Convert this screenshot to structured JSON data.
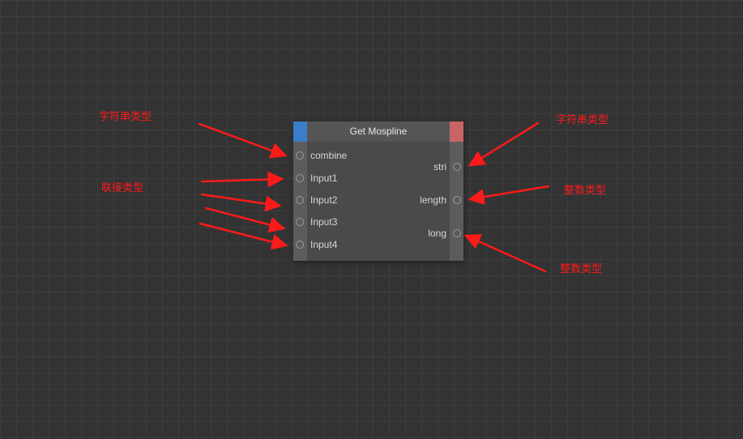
{
  "node": {
    "title": "Get Mospline",
    "inputs": [
      "combine",
      "Input1",
      "Input2",
      "Input3",
      "Input4"
    ],
    "outputs": [
      "stri",
      "length",
      "long"
    ]
  },
  "annotations": {
    "string_type_in": "字符串类型",
    "link_type": "联接类型",
    "string_type_out": "字符串类型",
    "int_type_length": "整数类型",
    "int_type_long": "整数类型"
  },
  "colors": {
    "canvas_bg": "#333333",
    "grid_line": "#3d3d3d",
    "node_body": "#4a4a4a",
    "input_accent": "#3a7dc9",
    "output_accent": "#c96464",
    "annotation_red": "#ff1a1a"
  }
}
